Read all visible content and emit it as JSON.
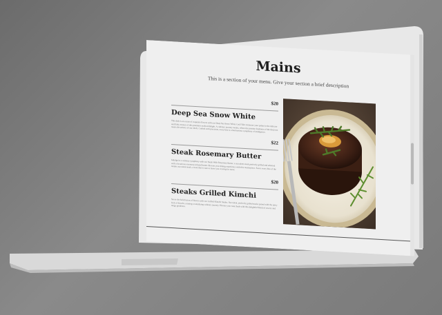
{
  "menu": {
    "title": "Mains",
    "description": "This is a section of your menu. Give your section a brief description",
    "items": [
      {
        "price": "$20",
        "name": "Deep Sea Snow White",
        "description": "This dish is an ocean of exquisite flavors with our Deep Sea Snow White Cod Fillet. Immerse your palate in the delicate and flaky texture of this premium seafood delight. A culinary journey awaits, where the pristine freshness of the deep sea meets the artistry of our chefs. Crafted with precision, every bite is a harmonious symphony of indulgence."
      },
      {
        "price": "$22",
        "name": "Steak Rosemary Butter",
        "description": "Indulge in a culinary symphony with our Steak With Rosemary Butter, a succulent steak perfectly grilled and adorned with a luxurious rosemary-infused butter. Elevate your dining experience with this masterpiece. Savor every bite of the tender, succulent steak, a treat that is sure to leave you craving for more."
      },
      {
        "price": "$20",
        "name": "Steaks Grilled Kimchi",
        "description": "Savor the bold fusion of flavors with our Grilled Kimchi Steaks. Succulent, perfectly grilled steaks paired with the spicy kick of kimchi, creating a tantalizing culinary journey. Elevate your taste buds with this delightful blend of savory and tangy goodness."
      }
    ]
  },
  "image": {
    "icon": "steak-dish-photo"
  }
}
